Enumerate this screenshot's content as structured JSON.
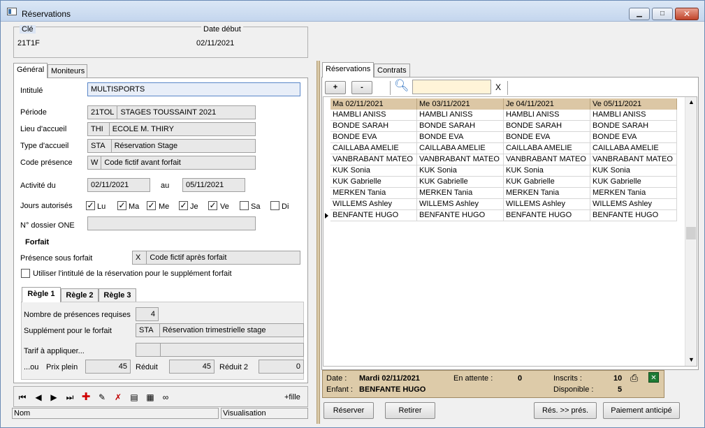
{
  "window": {
    "title": "Réservations",
    "controls": [
      "minimize-icon",
      "maximize-icon",
      "close-icon"
    ]
  },
  "header": {
    "cle_label": "Clé",
    "cle_value": "21T1F",
    "date_debut_label": "Date début",
    "date_debut_value": "02/11/2021"
  },
  "left_tabs": [
    "Général",
    "Moniteurs"
  ],
  "general": {
    "intitule_label": "Intitulé",
    "intitule_value": "MULTISPORTS",
    "periode_label": "Période",
    "periode_code": "21TOL",
    "periode_value": "STAGES TOUSSAINT 2021",
    "lieu_label": "Lieu d'accueil",
    "lieu_code": "THI",
    "lieu_value": "ECOLE M. THIRY",
    "type_label": "Type d'accueil",
    "type_code": "STA",
    "type_value": "Réservation Stage",
    "code_presence_label": "Code présence",
    "code_presence_code": "W",
    "code_presence_value": "Code fictif avant forfait",
    "activite_label": "Activité du",
    "activite_from": "02/11/2021",
    "activite_au": "au",
    "activite_to": "05/11/2021",
    "jours_label": "Jours autorisés",
    "jours": [
      {
        "label": "Lu",
        "checked": true
      },
      {
        "label": "Ma",
        "checked": true
      },
      {
        "label": "Me",
        "checked": true
      },
      {
        "label": "Je",
        "checked": true
      },
      {
        "label": "Ve",
        "checked": true
      },
      {
        "label": "Sa",
        "checked": false
      },
      {
        "label": "Di",
        "checked": false
      }
    ],
    "dossier_label": "N° dossier ONE",
    "dossier_value": "",
    "forfait_title": "Forfait",
    "presence_forfait_label": "Présence sous forfait",
    "presence_forfait_code": "X",
    "presence_forfait_value": "Code fictif après forfait",
    "utiliser_label": "Utiliser l'intitulé de la réservation pour le supplément forfait",
    "regle_tabs": [
      "Règle 1",
      "Règle 2",
      "Règle 3"
    ],
    "nb_presences_label": "Nombre de présences requises",
    "nb_presences_value": "4",
    "supplement_label": "Supplément pour le forfait",
    "supplement_code": "STA",
    "supplement_value": "Réservation trimestrielle stage",
    "tarif_label": "Tarif à appliquer...",
    "ou_label": "...ou",
    "prix_plein_label": "Prix plein",
    "prix_plein_value": "45",
    "reduit_label": "Réduit",
    "reduit_value": "45",
    "reduit2_label": "Réduit 2",
    "reduit2_value": "0"
  },
  "navbar": {
    "icons": [
      "first-icon",
      "prev-icon",
      "next-icon",
      "last-icon",
      "add-icon",
      "edit-icon",
      "delete-icon",
      "list-icon",
      "print-icon",
      "link-icon"
    ],
    "fille_label": "+fille"
  },
  "statusbar": {
    "nom_label": "Nom",
    "mode_label": "Visualisation"
  },
  "right_tabs": [
    "Réservations",
    "Contrats"
  ],
  "toolbar": {
    "plus_label": "+",
    "minus_label": "-",
    "search_value": "",
    "clear_label": "X"
  },
  "grid": {
    "columns": [
      "Ma 02/11/2021",
      "Me 03/11/2021",
      "Je 04/11/2021",
      "Ve 05/11/2021"
    ],
    "rows": [
      [
        "HAMBLI ANISS",
        "HAMBLI ANISS",
        "HAMBLI ANISS",
        "HAMBLI ANISS"
      ],
      [
        "BONDE SARAH",
        "BONDE SARAH",
        "BONDE SARAH",
        "BONDE SARAH"
      ],
      [
        "BONDE EVA",
        "BONDE EVA",
        "BONDE EVA",
        "BONDE EVA"
      ],
      [
        "CAILLABA AMELIE",
        "CAILLABA AMELIE",
        "CAILLABA AMELIE",
        "CAILLABA AMELIE"
      ],
      [
        "VANBRABANT MATEO",
        "VANBRABANT MATEO",
        "VANBRABANT MATEO",
        "VANBRABANT MATEO"
      ],
      [
        "KUK Sonia",
        "KUK Sonia",
        "KUK Sonia",
        "KUK Sonia"
      ],
      [
        "KUK Gabrielle",
        "KUK Gabrielle",
        "KUK Gabrielle",
        "KUK Gabrielle"
      ],
      [
        "MERKEN Tania",
        "MERKEN Tania",
        "MERKEN Tania",
        "MERKEN Tania"
      ],
      [
        "WILLEMS Ashley",
        "WILLEMS Ashley",
        "WILLEMS Ashley",
        "WILLEMS Ashley"
      ],
      [
        "BENFANTE HUGO",
        "BENFANTE HUGO",
        "BENFANTE HUGO",
        "BENFANTE HUGO"
      ]
    ]
  },
  "info": {
    "date_label": "Date :",
    "date_value": "Mardi 02/11/2021",
    "enfant_label": "Enfant :",
    "enfant_value": "BENFANTE HUGO",
    "attente_label": "En attente :",
    "attente_value": "0",
    "inscrits_label": "Inscrits :",
    "inscrits_value": "10",
    "disponible_label": "Disponible :",
    "disponible_value": "5"
  },
  "actions": {
    "reserver": "Réserver",
    "retirer": "Retirer",
    "res_pres": "Rés. >> prés.",
    "paiement": "Paiement anticipé"
  }
}
